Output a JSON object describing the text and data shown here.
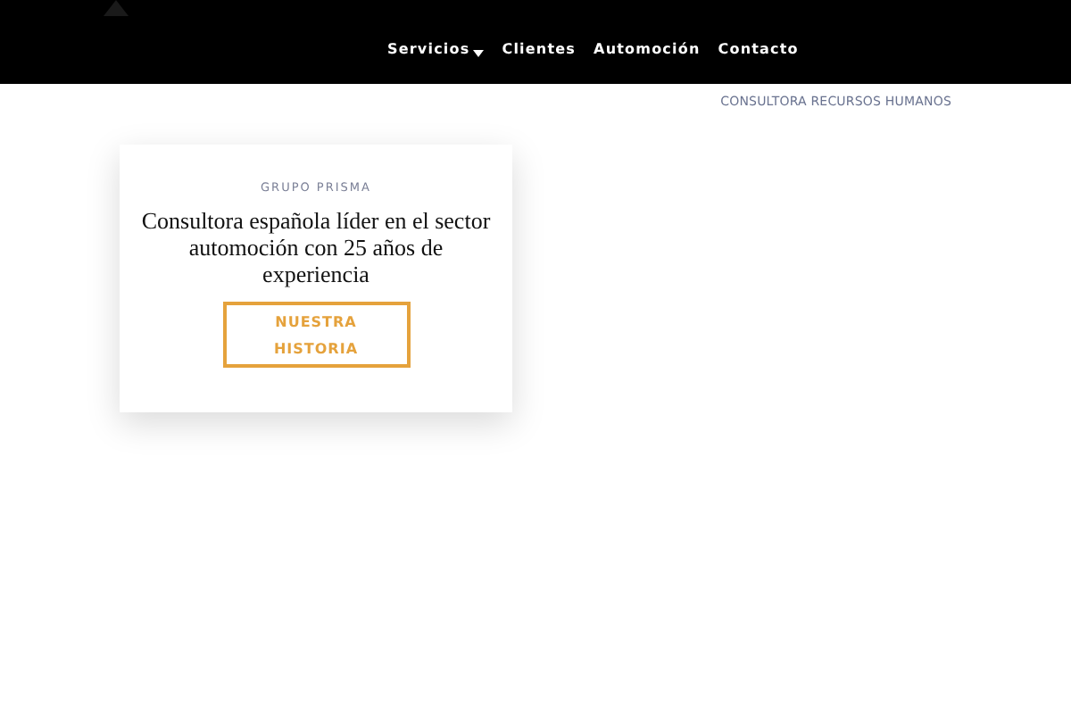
{
  "nav": [
    {
      "label": "Servicios",
      "has_dropdown": true
    },
    {
      "label": "Clientes",
      "has_dropdown": false
    },
    {
      "label": "Automoción",
      "has_dropdown": false
    },
    {
      "label": "Contacto",
      "has_dropdown": false
    }
  ],
  "tagline": "CONSULTORA RECURSOS HUMANOS",
  "card": {
    "eyebrow": "GRUPO PRISMA",
    "heading": "Consultora española líder en el sector automoción con 25 años de experiencia",
    "button": "NUESTRA HISTORIA"
  }
}
